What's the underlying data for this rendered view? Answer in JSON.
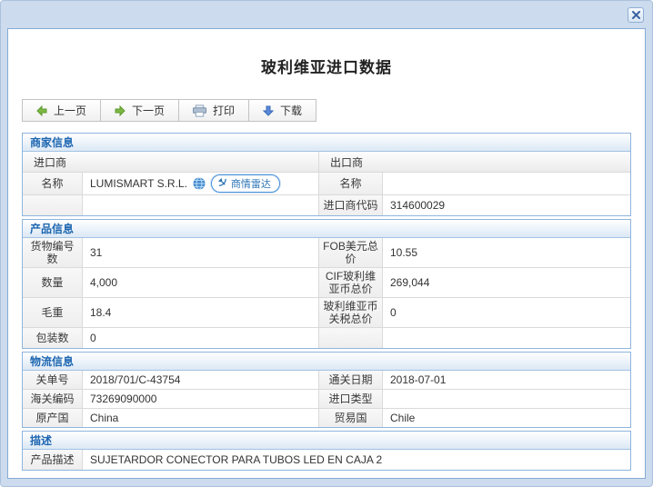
{
  "window": {
    "title": "玻利维亚进口数据"
  },
  "toolbar": {
    "prev_label": "上一页",
    "next_label": "下一页",
    "print_label": "打印",
    "download_label": "下载"
  },
  "colors": {
    "accent_blue": "#1d66b1",
    "green_arrow": "#7db843",
    "blue_arrow": "#5b8bd8",
    "frame_blue": "#ccdbed"
  },
  "sections": {
    "merchant": {
      "title": "商家信息",
      "importer_header": "进口商",
      "exporter_header": "出口商",
      "name_row": {
        "left_label": "名称",
        "left_value": "LUMISMART S.R.L.",
        "radar_label": "商情雷达",
        "right_label": "名称",
        "right_value": ""
      },
      "code_row": {
        "left_label": "",
        "left_value": "",
        "right_label": "进口商代码",
        "right_value": "314600029"
      }
    },
    "product": {
      "title": "产品信息",
      "rows": [
        {
          "l_label": "货物编号数",
          "l_value": "31",
          "r_label": "FOB美元总价",
          "r_value": "10.55"
        },
        {
          "l_label": "数量",
          "l_value": "4,000",
          "r_label": "CIF玻利维亚币总价",
          "r_value": "269,044"
        },
        {
          "l_label": "毛重",
          "l_value": "18.4",
          "r_label": "玻利维亚币关税总价",
          "r_value": "0"
        },
        {
          "l_label": "包装数",
          "l_value": "0",
          "r_label": "",
          "r_value": ""
        }
      ]
    },
    "logistics": {
      "title": "物流信息",
      "rows": [
        {
          "l_label": "关单号",
          "l_value": "2018/701/C-43754",
          "r_label": "通关日期",
          "r_value": "2018-07-01"
        },
        {
          "l_label": "海关编码",
          "l_value": "73269090000",
          "r_label": "进口类型",
          "r_value": ""
        },
        {
          "l_label": "原产国",
          "l_value": "China",
          "r_label": "贸易国",
          "r_value": "Chile"
        }
      ]
    },
    "description": {
      "title": "描述",
      "label": "产品描述",
      "value": "SUJETARDOR CONECTOR PARA TUBOS LED EN CAJA 2"
    }
  }
}
